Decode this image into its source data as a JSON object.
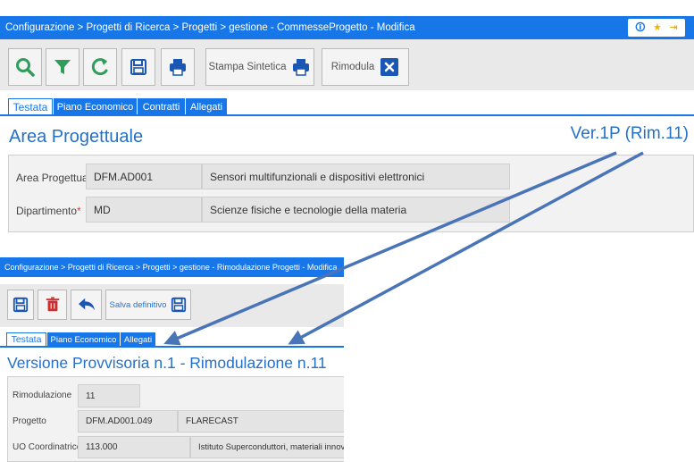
{
  "top": {
    "breadcrumb": "Configurazione > Progetti di Ricerca > Progetti > gestione - CommesseProgetto - Modifica",
    "toolbar": {
      "stampa_sintetica_label": "Stampa Sintetica",
      "rimodula_label": "Rimodula"
    },
    "tabs": [
      "Testata",
      "Piano Economico",
      "Contratti",
      "Allegati"
    ],
    "section_title": "Area Progettuale",
    "version_label": "Ver.1P (Rim.11)",
    "fields": {
      "area": {
        "label": "Area Progettuale",
        "code": "DFM.AD001",
        "description": "Sensori multifunzionali e dispositivi elettronici"
      },
      "dipartimento": {
        "label": "Dipartimento",
        "required_mark": "*",
        "code": "MD",
        "description": "Scienze fisiche e tecnologie della materia"
      }
    }
  },
  "bottom": {
    "breadcrumb": "Configurazione > Progetti di Ricerca > Progetti > gestione - Rimodulazione Progetti - Modifica",
    "toolbar": {
      "salva_definitivo_label": "Salva definitivo"
    },
    "tabs": [
      "Testata",
      "Piano Economico",
      "Allegati"
    ],
    "section_title": "Versione Provvisoria n.1 - Rimodulazione n.11",
    "fields": {
      "rimodulazione": {
        "label": "Rimodulazione",
        "value": "11"
      },
      "progetto": {
        "label": "Progetto",
        "code": "DFM.AD001.049",
        "description": "FLARECAST"
      },
      "uo": {
        "label": "UO Coordinatrice",
        "code": "113.000",
        "description": "Istituto Superconduttori, materiali innova"
      }
    }
  },
  "colors": {
    "accent": "#1877e8",
    "heading": "#2570c7",
    "arrow": "#4a74b8",
    "search_icon": "#2f9e5a",
    "filter_icon": "#2f9e5a",
    "refresh_icon": "#2f9e5a",
    "delete_icon": "#d12b2b",
    "undo_icon": "#1a57b5"
  },
  "icons": {
    "title_actions": [
      "info-icon",
      "star-icon",
      "exit-icon"
    ],
    "top_toolbar": [
      "search-icon",
      "filter-icon",
      "refresh-icon",
      "save-icon",
      "print-icon",
      "print-icon",
      "close-box-icon"
    ],
    "bottom_toolbar": [
      "save-icon",
      "delete-icon",
      "undo-icon",
      "save-icon"
    ]
  }
}
